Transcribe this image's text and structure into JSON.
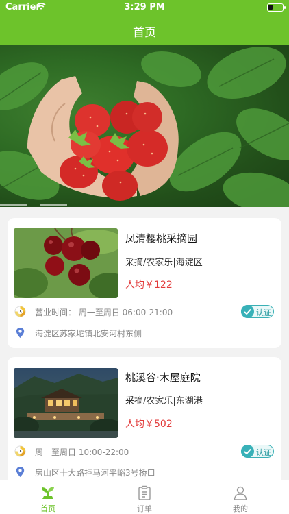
{
  "status_bar": {
    "carrier": "Carrier",
    "time": "3:29 PM"
  },
  "nav": {
    "title": "首页"
  },
  "colors": {
    "brand": "#6dc32b",
    "price": "#e23a3a",
    "badge": "#38b1b8"
  },
  "banner": {
    "image": "strawberries-in-hands"
  },
  "listings": [
    {
      "name": "凤清樱桃采摘园",
      "tags": "采摘/农家乐|海淀区",
      "price": "人均￥122",
      "hours": "营业时间： 周一至周日 06:00-21:00",
      "address": "海淀区苏家坨镇北安河村东侧",
      "badge": "认证",
      "image": "cherries"
    },
    {
      "name": "桃溪谷·木屋庭院",
      "tags": "采摘/农家乐|东湖港",
      "price": "人均￥502",
      "hours": "周一至周日 10:00-22:00",
      "address": "房山区十大路拒马河平峪3号桥口",
      "badge": "认证",
      "image": "wooden-lodge-at-dusk"
    }
  ],
  "tabs": [
    {
      "label": "首页",
      "icon": "home-sprout-icon",
      "active": true
    },
    {
      "label": "订单",
      "icon": "clipboard-icon",
      "active": false
    },
    {
      "label": "我的",
      "icon": "person-icon",
      "active": false
    }
  ]
}
